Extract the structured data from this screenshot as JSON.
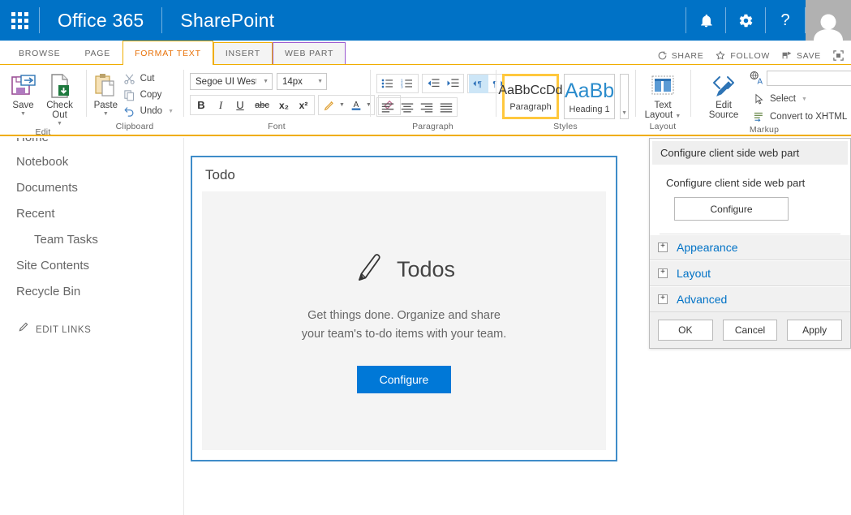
{
  "suitebar": {
    "waffle": "app-launcher",
    "office_label": "Office 365",
    "app_label": "SharePoint",
    "notifications_icon": "bell-icon",
    "settings_icon": "gear-icon",
    "help_icon": "question-mark-icon",
    "avatar": "user-avatar"
  },
  "tabs": [
    {
      "label": "BROWSE",
      "state": "plain"
    },
    {
      "label": "PAGE",
      "state": "plain"
    },
    {
      "label": "FORMAT TEXT",
      "state": "active"
    },
    {
      "label": "INSERT",
      "state": "boxed"
    },
    {
      "label": "WEB PART",
      "state": "boxed-purple"
    }
  ],
  "tab_actions": [
    {
      "label": "SHARE",
      "icon": "share-icon"
    },
    {
      "label": "FOLLOW",
      "icon": "star-icon"
    },
    {
      "label": "SAVE",
      "icon": "save-icon"
    },
    {
      "label": "",
      "icon": "focus-on-content-icon"
    }
  ],
  "ribbon": {
    "edit": {
      "group_label": "Edit",
      "save": "Save",
      "check_out": "Check Out"
    },
    "clipboard": {
      "group_label": "Clipboard",
      "paste": "Paste",
      "cut": "Cut",
      "copy": "Copy",
      "undo": "Undo"
    },
    "font": {
      "group_label": "Font",
      "font_family": "Segoe UI WestE",
      "font_size": "14px",
      "bold": "B",
      "italic": "I",
      "underline": "U",
      "strikethrough": "abc",
      "subscript": "x₂",
      "superscript": "x²",
      "highlight_icon": "highlight-color-icon",
      "fontcolor_icon": "font-color-icon",
      "clearformat_icon": "clear-format-icon"
    },
    "paragraph": {
      "group_label": "Paragraph",
      "bullets_icon": "bulleted-list-icon",
      "numbering_icon": "numbered-list-icon",
      "decrease_indent_icon": "decrease-indent-icon",
      "increase_indent_icon": "increase-indent-icon",
      "ltr_icon": "left-to-right-icon",
      "rtl_icon": "right-to-left-icon",
      "align_left_icon": "align-left-icon",
      "align_center_icon": "align-center-icon",
      "align_right_icon": "align-right-icon",
      "justify_icon": "justify-icon"
    },
    "styles": {
      "group_label": "Styles",
      "items": [
        {
          "sample": "AaBbCcDd",
          "name": "Paragraph",
          "selected": true
        },
        {
          "sample": "AaBb",
          "name": "Heading 1",
          "selected": false
        }
      ]
    },
    "layout": {
      "group_label": "Layout",
      "text_layout": "Text\nLayout"
    },
    "markup": {
      "group_label": "Markup",
      "edit_source": "Edit\nSource",
      "markup_styles_value": "",
      "select": "Select",
      "convert": "Convert to XHTML"
    }
  },
  "sidebar": {
    "clipped_top_item": "Home",
    "items": [
      {
        "label": "Notebook",
        "sub": false
      },
      {
        "label": "Documents",
        "sub": false
      },
      {
        "label": "Recent",
        "sub": false
      },
      {
        "label": "Team Tasks",
        "sub": true
      },
      {
        "label": "Site Contents",
        "sub": false
      },
      {
        "label": "Recycle Bin",
        "sub": false
      }
    ],
    "edit_links": "EDIT LINKS"
  },
  "webpart": {
    "title": "Todo",
    "app_name": "Todos",
    "pencil_icon": "pencil-icon",
    "description": "Get things done. Organize and share\nyour team's to-do items with your team.",
    "description_line1": "Get things done. Organize and share",
    "description_line2": "your team's to-do items with your team.",
    "configure_button": "Configure"
  },
  "property_pane": {
    "title": "Configure client side web part",
    "section_label": "Configure client side web part",
    "configure_button": "Configure",
    "accordions": [
      {
        "label": "Appearance",
        "expander": "+"
      },
      {
        "label": "Layout",
        "expander": "+"
      },
      {
        "label": "Advanced",
        "expander": "+"
      }
    ],
    "ok": "OK",
    "cancel": "Cancel",
    "apply": "Apply"
  },
  "colors": {
    "suite_blue": "#0072c6",
    "accent_blue": "#0078d7",
    "ribbon_orange": "#f0ad00",
    "active_tab_text": "#e8730b",
    "webpart_border": "#3f8cc9",
    "webpart_bg": "#f4f4f4",
    "style_selected": "#ffc83d",
    "webpart_tab_purple": "#9b59d0"
  }
}
